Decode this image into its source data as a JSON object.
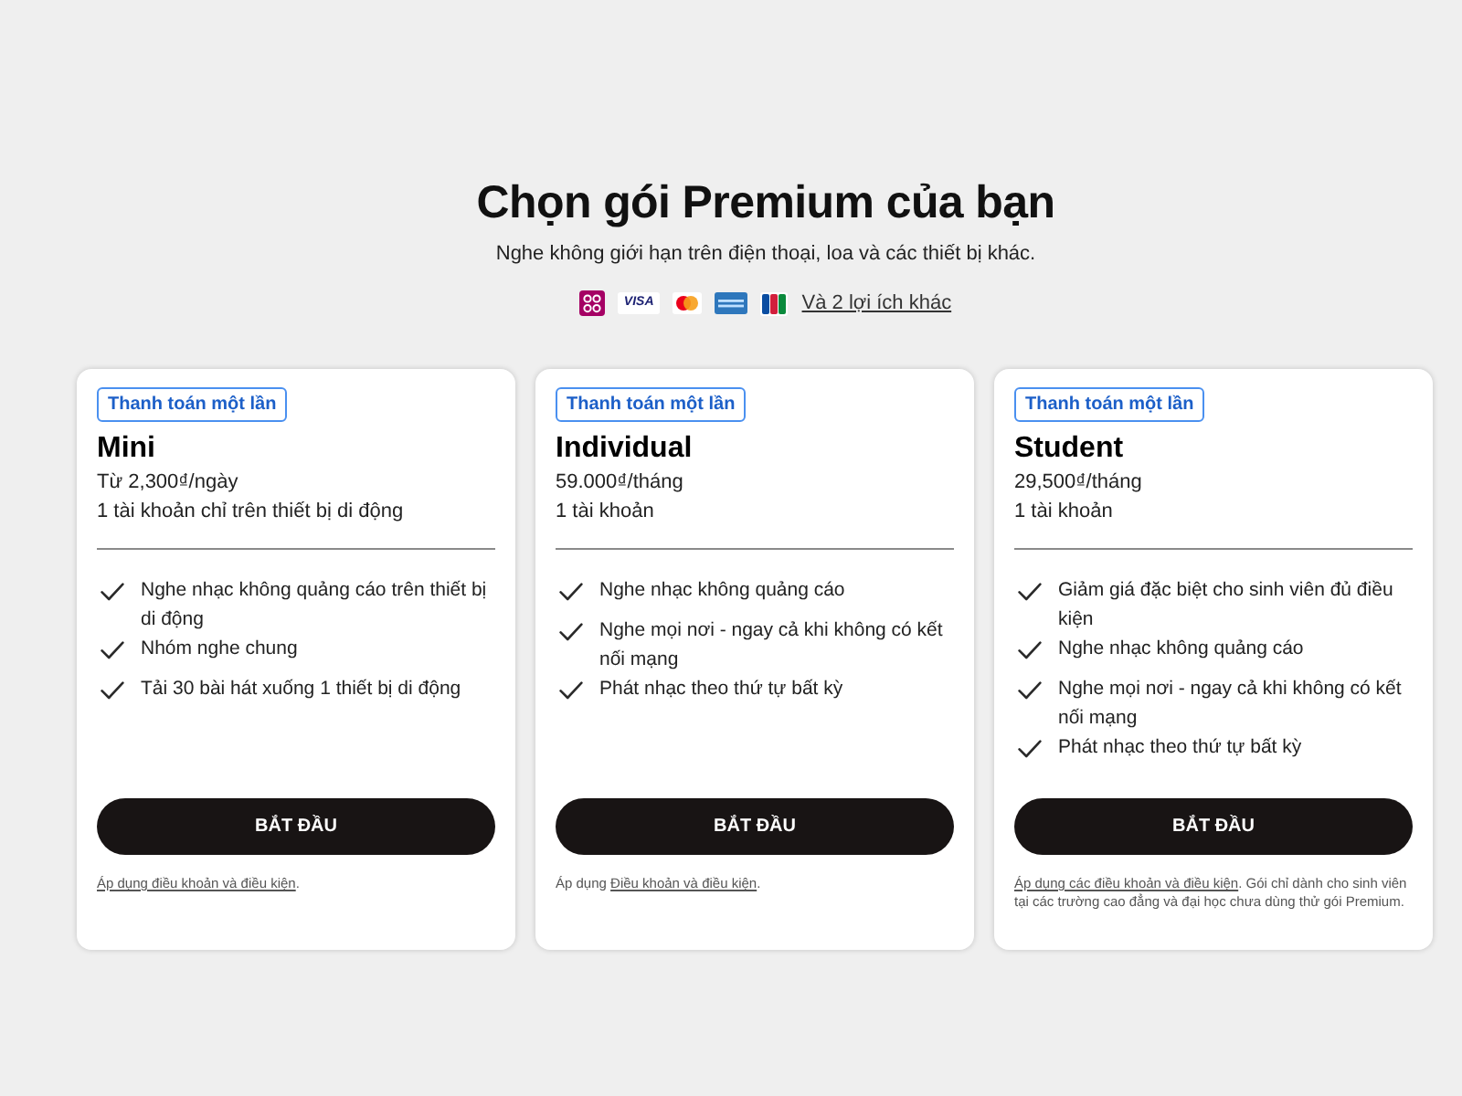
{
  "header": {
    "title": "Chọn gói Premium của bạn",
    "subtitle": "Nghe không giới hạn trên điện thoại, loa và các thiết bị khác.",
    "payment_methods": [
      {
        "kind": "momo"
      },
      {
        "kind": "visa",
        "label": "VISA"
      },
      {
        "kind": "mastercard"
      },
      {
        "kind": "amex"
      },
      {
        "kind": "jcb"
      }
    ],
    "more_link": "Và 2 lợi ích khác"
  },
  "plans": [
    {
      "badge": "Thanh toán một lần",
      "name": "Mini",
      "price": "Từ 2,300₫/ngày",
      "accounts": "1 tài khoản chỉ trên thiết bị di động",
      "features": [
        "Nghe nhạc không quảng cáo trên thiết bị di động",
        "Nhóm nghe chung",
        "Tải 30 bài hát xuống 1 thiết bị di động"
      ],
      "button": "BẮT ĐẦU",
      "terms": {
        "link": "Áp dụng điều khoản và điều kiện",
        "after": "."
      }
    },
    {
      "badge": "Thanh toán một lần",
      "name": "Individual",
      "price": "59.000₫/tháng",
      "accounts": "1 tài khoản",
      "features": [
        "Nghe nhạc không quảng cáo",
        "Nghe mọi nơi - ngay cả khi không có kết nối mạng",
        "Phát nhạc theo thứ tự bất kỳ"
      ],
      "button": "BẮT ĐẦU",
      "terms": {
        "before": "Áp dụng ",
        "link": "Điều khoản và điều kiện",
        "after": "."
      }
    },
    {
      "badge": "Thanh toán một lần",
      "name": "Student",
      "price": "29,500₫/tháng",
      "accounts": "1 tài khoản",
      "features": [
        "Giảm giá đặc biệt cho sinh viên đủ điều kiện",
        "Nghe nhạc không quảng cáo",
        "Nghe mọi nơi - ngay cả khi không có kết nối mạng",
        "Phát nhạc theo thứ tự bất kỳ"
      ],
      "button": "BẮT ĐẦU",
      "terms": {
        "link": "Áp dụng các điều khoản và điều kiện",
        "after": ". Gói chỉ dành cho sinh viên tại các trường cao đẳng và đại học chưa dùng thử gói Premium."
      }
    }
  ]
}
